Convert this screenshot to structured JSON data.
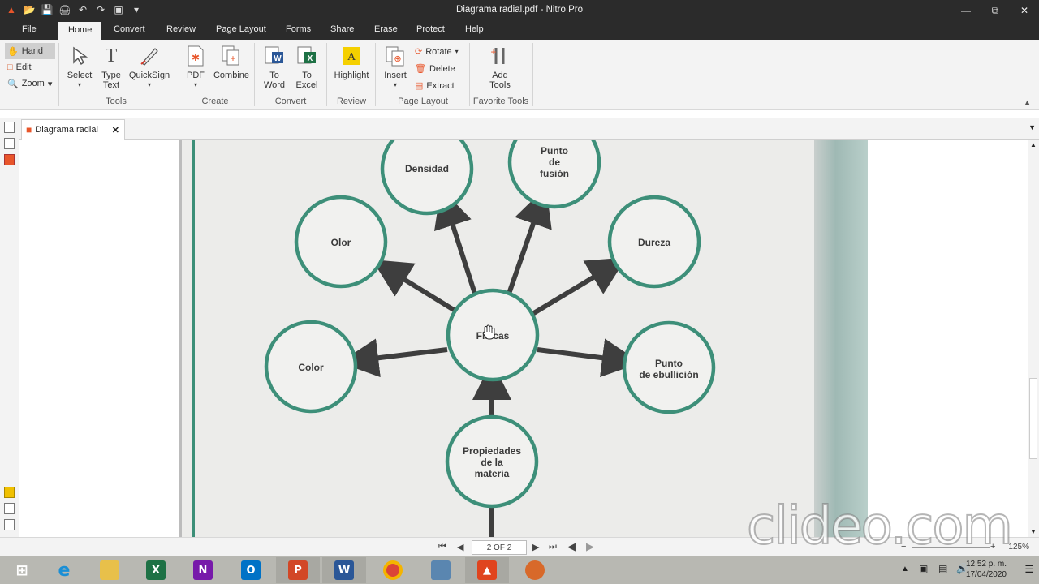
{
  "window": {
    "title": "Diagrama radial.pdf - Nitro Pro"
  },
  "menu": {
    "file": "File",
    "tabs": [
      "Home",
      "Convert",
      "Review",
      "Page Layout",
      "Forms",
      "Share",
      "Erase",
      "Protect",
      "Help"
    ]
  },
  "ribbon": {
    "modes": [
      "Hand",
      "Edit",
      "Zoom"
    ],
    "tools": {
      "select": "Select",
      "type_text_1": "Type",
      "type_text_2": "Text",
      "quicksign": "QuickSign",
      "group": "Tools"
    },
    "create": {
      "pdf": "PDF",
      "combine": "Combine",
      "group": "Create"
    },
    "convert": {
      "to_word_1": "To",
      "to_word_2": "Word",
      "to_excel_1": "To",
      "to_excel_2": "Excel",
      "group": "Convert"
    },
    "review": {
      "highlight": "Highlight",
      "group": "Review"
    },
    "page_layout": {
      "insert": "Insert",
      "rotate": "Rotate",
      "delete": "Delete",
      "extract": "Extract",
      "group": "Page Layout"
    },
    "favorite": {
      "add_1": "Add",
      "add_2": "Tools",
      "group": "Favorite Tools"
    }
  },
  "document_tab": {
    "label": "Diagrama radial"
  },
  "diagram": {
    "center": "Físicas",
    "nodes": {
      "densidad": "Densidad",
      "punto_fusion": [
        "Punto",
        "de",
        "fusión"
      ],
      "olor": "Olor",
      "dureza": "Dureza",
      "color": "Color",
      "punto_ebullicion": [
        "Punto",
        "de ebullición"
      ],
      "propiedades": [
        "Propiedades",
        "de la",
        "materia"
      ]
    },
    "colors": {
      "ring": "#3d8f79",
      "arrow": "#3e3e3e"
    }
  },
  "status": {
    "page": "2 OF 2",
    "zoom": "125%"
  },
  "watermark": "clideo.com",
  "taskbar": {
    "time": "12:52 p. m.",
    "date": "17/04/2020",
    "apps": [
      "windows-start",
      "internet-explorer",
      "file-explorer",
      "excel",
      "onenote",
      "outlook",
      "powerpoint",
      "word",
      "chrome",
      "photos",
      "nitro-pro",
      "other-app"
    ]
  }
}
